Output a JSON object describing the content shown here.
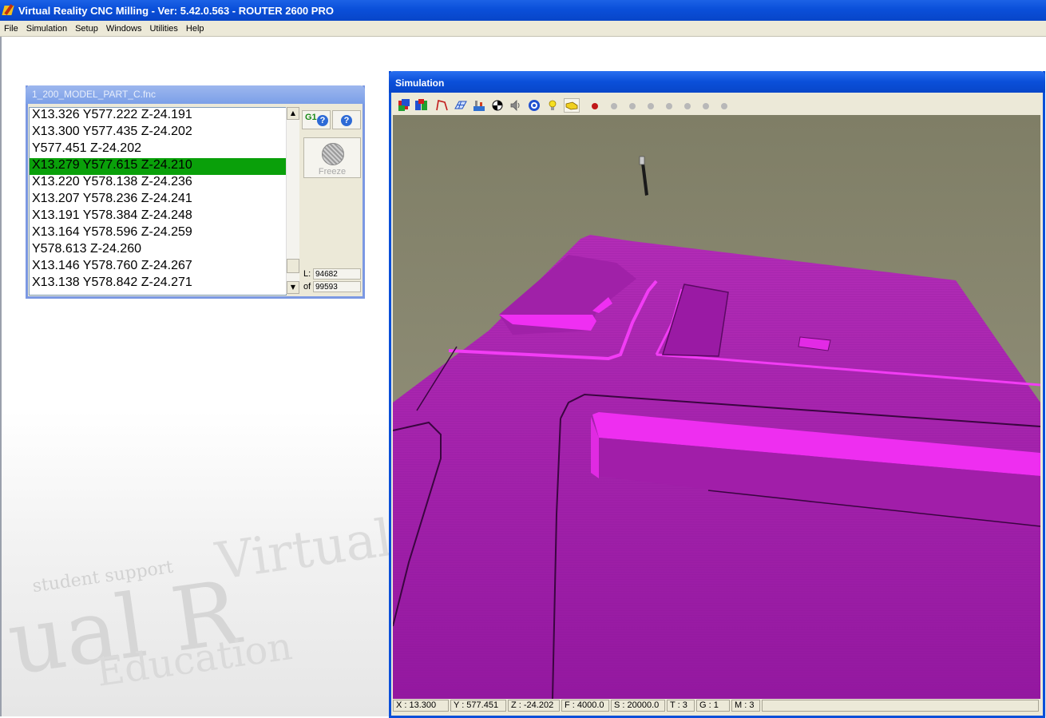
{
  "app": {
    "title": "Virtual Reality CNC Milling  -  Ver: 5.42.0.563 - ROUTER 2600 PRO"
  },
  "menu": [
    "File",
    "Simulation",
    "Setup",
    "Windows",
    "Utilities",
    "Help"
  ],
  "gcode_window": {
    "title": "1_200_MODEL_PART_C.fnc",
    "lines": [
      "X13.326 Y577.222 Z-24.191",
      "X13.300 Y577.435 Z-24.202",
      "Y577.451 Z-24.202",
      "X13.279 Y577.615 Z-24.210",
      "X13.220 Y578.138 Z-24.236",
      "X13.207 Y578.236 Z-24.241",
      "X13.191 Y578.384 Z-24.248",
      "X13.164 Y578.596 Z-24.259",
      "Y578.613 Z-24.260",
      "X13.146 Y578.760 Z-24.267",
      "X13.138 Y578.842 Z-24.271"
    ],
    "selected_index": 3,
    "g1_label": "G1",
    "help_label": "?",
    "freeze_label": "Freeze",
    "line_label": "L:",
    "line_value": "94682",
    "of_label": "of",
    "of_value": "99593"
  },
  "simulation_window": {
    "title": "Simulation",
    "toolbar_icons": [
      "3d-view-icon",
      "top-view-icon",
      "tool-path-icon",
      "grid-icon",
      "machine-icon",
      "center-icon",
      "sound-icon",
      "target-icon",
      "light-icon",
      "highlight-icon"
    ],
    "status": {
      "x": "X : 13.300",
      "y": "Y : 577.451",
      "z": "Z : -24.202",
      "f": "F : 4000.0",
      "s": "S : 20000.0",
      "t": "T : 3",
      "g": "G : 1",
      "m": "M : 3"
    }
  },
  "watermark": [
    "student support",
    "Virtual",
    "ual R",
    "Education"
  ],
  "colors": {
    "workpiece": "#9c1ca0",
    "workpiece_highlight": "#ee2ef0",
    "background": "#8c8a72",
    "selected_line": "#0aa00a",
    "title_active": "#0a4fd9"
  }
}
